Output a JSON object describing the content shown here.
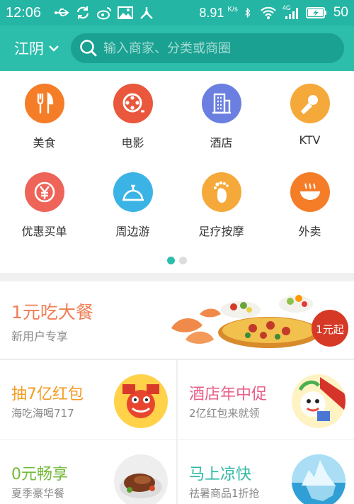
{
  "status_bar": {
    "time": "12:06",
    "net_speed": "8.91",
    "net_speed_unit": "K/s",
    "network_badge": "4G",
    "battery": "50"
  },
  "header": {
    "city": "江阴",
    "search_placeholder": "输入商家、分类或商圈"
  },
  "categories": [
    {
      "label": "美食",
      "icon": "fork-knife-icon",
      "color": "#f57d28"
    },
    {
      "label": "电影",
      "icon": "film-reel-icon",
      "color": "#e9573c"
    },
    {
      "label": "酒店",
      "icon": "building-icon",
      "color": "#6a7fe0"
    },
    {
      "label": "KTV",
      "icon": "microphone-icon",
      "color": "#f6a93b"
    },
    {
      "label": "优惠买单",
      "icon": "yen-coupon-icon",
      "color": "#ee6459"
    },
    {
      "label": "周边游",
      "icon": "travel-bag-icon",
      "color": "#3bb4e5"
    },
    {
      "label": "足疗按摩",
      "icon": "footprint-icon",
      "color": "#f6a93b"
    },
    {
      "label": "外卖",
      "icon": "bowl-icon",
      "color": "#f57d28"
    }
  ],
  "pager": {
    "count": 2,
    "active": 0
  },
  "promos": {
    "main": {
      "title": "1元吃大餐",
      "subtitle": "新用户专享",
      "badge": "1元起"
    },
    "items": [
      {
        "title": "抽7亿红包",
        "subtitle": "海吃海喝717",
        "title_color": "#f39c22"
      },
      {
        "title": "酒店年中促",
        "subtitle": "2亿红包来就领",
        "title_color": "#e85f88"
      },
      {
        "title": "0元畅享",
        "subtitle": "夏季豪华餐",
        "title_color": "#73b93a"
      },
      {
        "title": "马上凉快",
        "subtitle": "祛暑商品1折抢",
        "title_color": "#2eb7a5"
      }
    ]
  }
}
